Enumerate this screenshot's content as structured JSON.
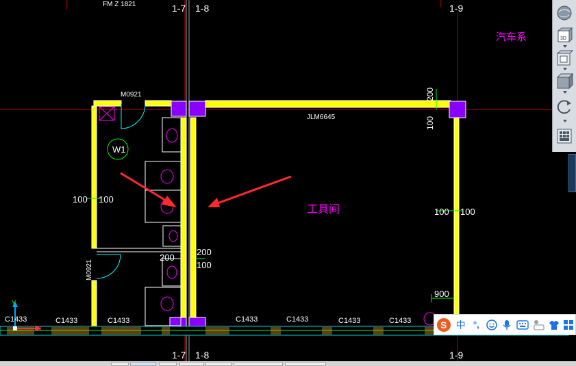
{
  "drawing": {
    "top_partial_label": "FM Z 1821",
    "axis_top_left": "1-7",
    "axis_top_mid": "1-8",
    "axis_top_right": "1-9",
    "axis_bottom_left": "1-7",
    "axis_bottom_mid": "1-8",
    "axis_bottom_right": "1-9",
    "door_top": "M0921",
    "door_left": "M0921",
    "beam_label": "JLM6645",
    "room_tag": "W1",
    "room_name": "工具间",
    "annotation_right": "汽车系",
    "dim_left_a": "100",
    "dim_left_b": "100",
    "dim_right_a": "100",
    "dim_right_b": "100",
    "dim_top_200": "200",
    "dim_top_100": "100",
    "dim_wall_200": "200",
    "dim_wall_100": "100",
    "dim_lower_200": "200",
    "dim_900": "900",
    "window_labels": [
      "C1433",
      "C1433",
      "C1433",
      "C1433",
      "C1433",
      "C1433",
      "C1433"
    ],
    "ucs_y": "Y",
    "ucs_x": "X"
  },
  "colors": {
    "background": "#000000",
    "wall_fill": "#ffff00",
    "column": "#8800ff",
    "axis_line": "#cc0000",
    "fixture": "#ff00ff",
    "dimension": "#00ff00",
    "text": "#ffffff",
    "arrow": "#ff2a2a"
  },
  "toolbar": {
    "icons": [
      "globe-icon",
      "view-3d-icon",
      "view-cube-icon",
      "box-icon",
      "orbit-icon",
      "grid-menu-icon"
    ],
    "label_3d": "3D"
  },
  "ime": {
    "logo": "S",
    "mode_label": "中",
    "punct_label": "°,",
    "icons": [
      "emoji-icon",
      "mic-icon",
      "keyboard-icon",
      "user-keyboard-icon",
      "shirt-icon",
      "grid-icon"
    ]
  }
}
